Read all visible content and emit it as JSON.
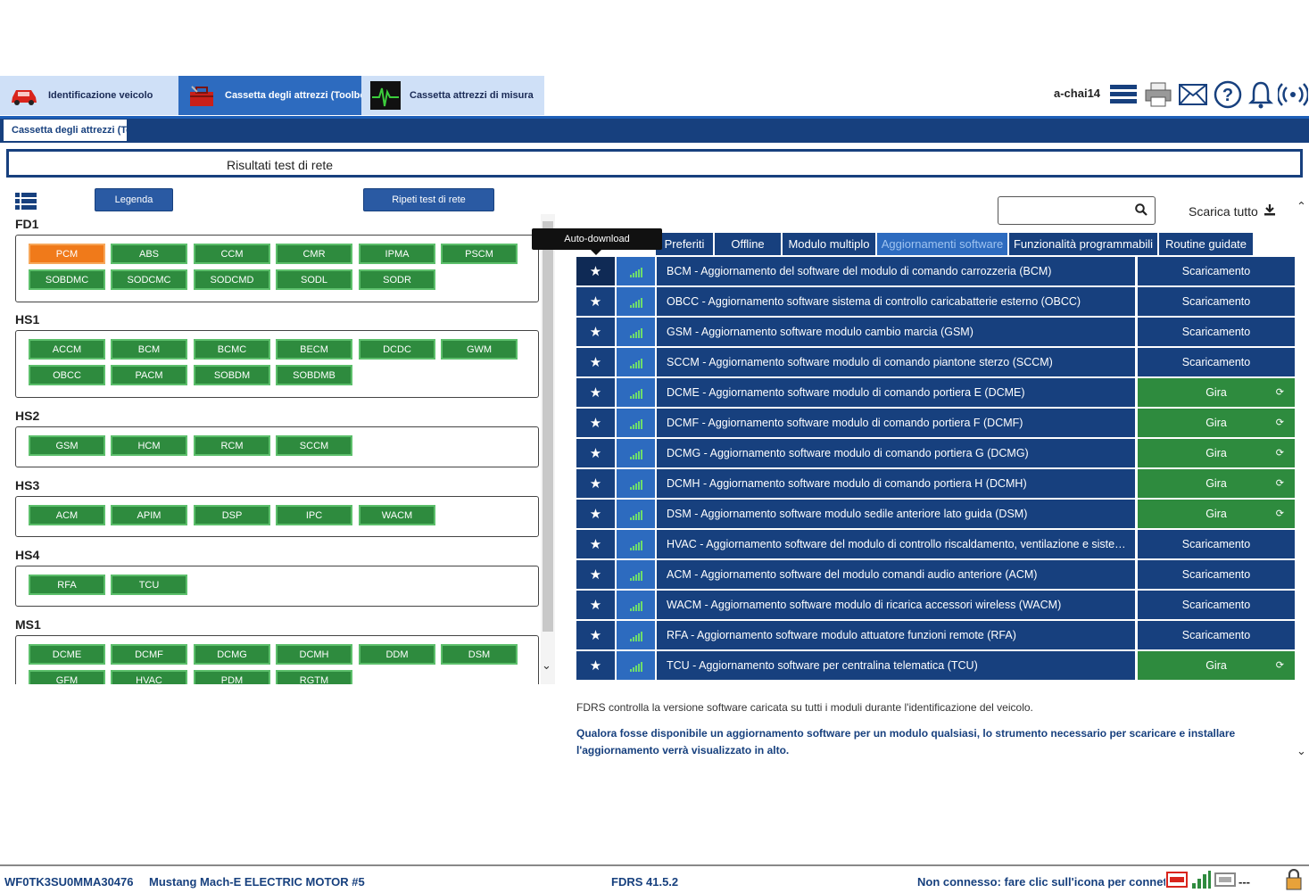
{
  "top_tabs": [
    {
      "label": "Identificazione veicolo",
      "icon": "car-icon"
    },
    {
      "label": "Cassetta degli attrezzi (Toolbox)",
      "icon": "toolbox-icon"
    },
    {
      "label": "Cassetta attrezzi di misura",
      "icon": "oscilloscope-icon"
    }
  ],
  "header": {
    "user": "a-chai14"
  },
  "subtab": "Cassetta degli attrezzi (Toolbox)",
  "page_title": "Risultati test di rete",
  "buttons": {
    "legend": "Legenda",
    "repeat": "Ripeti test di rete"
  },
  "groups": [
    {
      "label": "FD1",
      "modules": [
        "PCM",
        "ABS",
        "CCM",
        "CMR",
        "IPMA",
        "PSCM",
        "SOBDMC",
        "SODCMC",
        "SODCMD",
        "SODL",
        "SODR"
      ]
    },
    {
      "label": "HS1",
      "modules": [
        "ACCM",
        "BCM",
        "BCMC",
        "BECM",
        "DCDC",
        "GWM",
        "OBCC",
        "PACM",
        "SOBDM",
        "SOBDMB"
      ]
    },
    {
      "label": "HS2",
      "modules": [
        "GSM",
        "HCM",
        "RCM",
        "SCCM"
      ]
    },
    {
      "label": "HS3",
      "modules": [
        "ACM",
        "APIM",
        "DSP",
        "IPC",
        "WACM"
      ]
    },
    {
      "label": "HS4",
      "modules": [
        "RFA",
        "TCU"
      ]
    },
    {
      "label": "MS1",
      "modules": [
        "DCME",
        "DCMF",
        "DCMG",
        "DCMH",
        "DDM",
        "DSM",
        "GFM",
        "HVAC",
        "PDM",
        "RGTM"
      ]
    }
  ],
  "highlighted_module": "PCM",
  "tooltip": "Auto-download",
  "right_tabs": [
    "Preferiti",
    "Offline",
    "Modulo multiplo",
    "Aggiornamenti software",
    "Funzionalità programmabili",
    "Routine guidate"
  ],
  "active_right_tab": "Aggiornamenti software",
  "search": {
    "placeholder": ""
  },
  "download_all": "Scarica tutto",
  "updates": [
    {
      "desc": "BCM - Aggiornamento del software del modulo di comando carrozzeria (BCM)",
      "action": "Scaricamento",
      "kind": "dl"
    },
    {
      "desc": "OBCC - Aggiornamento software sistema di controllo caricabatterie esterno (OBCC)",
      "action": "Scaricamento",
      "kind": "dl"
    },
    {
      "desc": "GSM - Aggiornamento software modulo cambio marcia (GSM)",
      "action": "Scaricamento",
      "kind": "dl"
    },
    {
      "desc": "SCCM - Aggiornamento software modulo di comando piantone sterzo (SCCM)",
      "action": "Scaricamento",
      "kind": "dl"
    },
    {
      "desc": "DCME - Aggiornamento software modulo di comando portiera E (DCME)",
      "action": "Gira",
      "kind": "run"
    },
    {
      "desc": "DCMF - Aggiornamento software modulo di comando portiera F (DCMF)",
      "action": "Gira",
      "kind": "run"
    },
    {
      "desc": "DCMG - Aggiornamento software modulo di comando portiera G (DCMG)",
      "action": "Gira",
      "kind": "run"
    },
    {
      "desc": "DCMH - Aggiornamento software modulo di comando portiera H (DCMH)",
      "action": "Gira",
      "kind": "run"
    },
    {
      "desc": "DSM - Aggiornamento software modulo sedile anteriore lato guida (DSM)",
      "action": "Gira",
      "kind": "run"
    },
    {
      "desc": "HVAC - Aggiornamento software del modulo di controllo riscaldamento, ventilazione e sistema di...",
      "action": "Scaricamento",
      "kind": "dl"
    },
    {
      "desc": "ACM - Aggiornamento software del modulo comandi audio anteriore (ACM)",
      "action": "Scaricamento",
      "kind": "dl"
    },
    {
      "desc": "WACM - Aggiornamento software modulo di ricarica accessori wireless (WACM)",
      "action": "Scaricamento",
      "kind": "dl"
    },
    {
      "desc": "RFA - Aggiornamento software modulo attuatore funzioni remote (RFA)",
      "action": "Scaricamento",
      "kind": "dl"
    },
    {
      "desc": "TCU - Aggiornamento software per centralina telematica (TCU)",
      "action": "Gira",
      "kind": "run"
    }
  ],
  "info": {
    "line1": "FDRS controlla la versione software caricata su tutti i moduli durante l'identificazione del veicolo.",
    "line2": "Qualora fosse disponibile un aggiornamento software per un modulo qualsiasi, lo strumento necessario per scaricare e installare l'aggiornamento verrà visualizzato in alto."
  },
  "status": {
    "vin": "WF0TK3SU0MMA30476",
    "vehicle": "Mustang Mach-E ELECTRIC MOTOR #5",
    "version": "FDRS 41.5.2",
    "connection": "Non connesso: fare clic sull'icona per connettersi",
    "dashes": "---"
  },
  "colors": {
    "navy": "#17407e",
    "green": "#2e8b3e",
    "orange": "#f07a1a",
    "tab_light": "#cfe0f7",
    "tab_active": "#2d6bbf"
  }
}
